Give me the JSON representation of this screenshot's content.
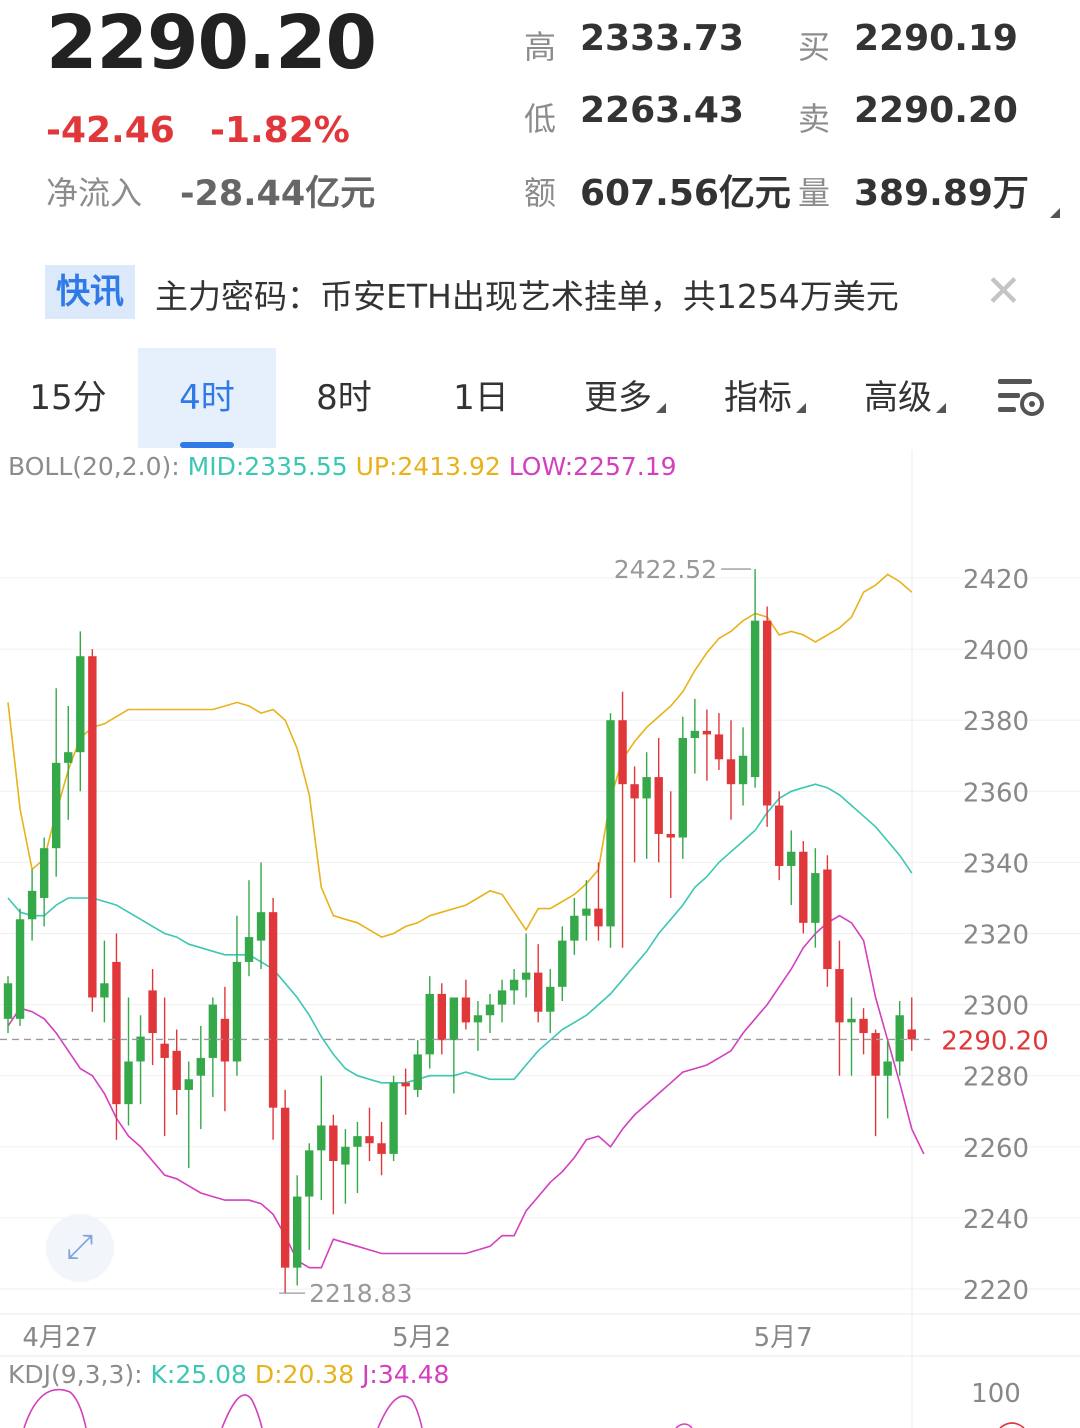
{
  "quote": {
    "last_price": "2290.20",
    "change": "-42.46",
    "change_pct": "-1.82%",
    "net_inflow_label": "净流入",
    "net_inflow_value": "-28.44亿元",
    "stats": [
      {
        "label": "高",
        "value": "2333.73"
      },
      {
        "label": "买",
        "value": "2290.19"
      },
      {
        "label": "低",
        "value": "2263.43"
      },
      {
        "label": "卖",
        "value": "2290.20"
      },
      {
        "label": "额",
        "value": "607.56亿元"
      },
      {
        "label": "量",
        "value": "389.89万"
      }
    ]
  },
  "news": {
    "tag": "快讯",
    "text": "主力密码：币安ETH出现艺术挂单，共1254万美元",
    "close_icon": "close-icon"
  },
  "tabs": [
    {
      "label": "15分",
      "active": false,
      "dropdown": false
    },
    {
      "label": "4时",
      "active": true,
      "dropdown": false
    },
    {
      "label": "8时",
      "active": false,
      "dropdown": false
    },
    {
      "label": "1日",
      "active": false,
      "dropdown": false
    },
    {
      "label": "更多",
      "active": false,
      "dropdown": true
    },
    {
      "label": "指标",
      "active": false,
      "dropdown": true
    },
    {
      "label": "高级",
      "active": false,
      "dropdown": true
    }
  ],
  "settings_icon": "chart-settings-icon",
  "expand_icon": "expand-icon",
  "colors": {
    "up": "#35a84a",
    "down": "#e0373b",
    "mid": "#3cc7b4",
    "upper": "#e8b21a",
    "lower": "#d43fbf",
    "accent": "#2f7ae6",
    "current_price_label": "#e0373b"
  },
  "boll_legend": {
    "prefix": "BOLL(20,2.0):",
    "mid": "MID:2335.55",
    "up": "UP:2413.92",
    "low": "LOW:2257.19"
  },
  "kdj_legend": {
    "prefix": "KDJ(9,3,3):",
    "k": "K:25.08",
    "d": "D:20.38",
    "j": "J:34.48"
  },
  "chart_data": {
    "type": "candlestick",
    "y_ticks": [
      "2420",
      "2400",
      "2380",
      "2360",
      "2340",
      "2320",
      "2300",
      "2280",
      "2260",
      "2240",
      "2220"
    ],
    "ylim": [
      2215,
      2435
    ],
    "x_labels": [
      {
        "label": "4月27",
        "index": 4
      },
      {
        "label": "5月2",
        "index": 34
      },
      {
        "label": "5月7",
        "index": 64
      }
    ],
    "current_price": 2290.2,
    "current_price_label": "2290.20",
    "max_marker": {
      "label": "2422.52",
      "value": 2422.52,
      "index": 62
    },
    "min_marker": {
      "label": "2218.83",
      "value": 2218.83,
      "index": 22
    },
    "candles": [
      [
        2296,
        2308,
        2292,
        2306
      ],
      [
        2296,
        2327,
        2294,
        2324
      ],
      [
        2324,
        2338,
        2318,
        2332
      ],
      [
        2330,
        2347,
        2322,
        2344
      ],
      [
        2344,
        2389,
        2336,
        2368
      ],
      [
        2368,
        2384,
        2352,
        2371
      ],
      [
        2371,
        2405,
        2360,
        2398
      ],
      [
        2398,
        2400,
        2298,
        2302
      ],
      [
        2302,
        2318,
        2295,
        2306
      ],
      [
        2312,
        2320,
        2262,
        2272
      ],
      [
        2272,
        2302,
        2266,
        2284
      ],
      [
        2284,
        2297,
        2272,
        2291
      ],
      [
        2304,
        2310,
        2283,
        2292
      ],
      [
        2289,
        2302,
        2263,
        2285
      ],
      [
        2287,
        2293,
        2269,
        2276
      ],
      [
        2276,
        2284,
        2254,
        2279
      ],
      [
        2280,
        2294,
        2265,
        2285
      ],
      [
        2285,
        2302,
        2274,
        2300
      ],
      [
        2296,
        2305,
        2270,
        2284
      ],
      [
        2284,
        2325,
        2280,
        2312
      ],
      [
        2312,
        2335,
        2308,
        2319
      ],
      [
        2318,
        2340,
        2310,
        2326
      ],
      [
        2326,
        2330,
        2262,
        2271
      ],
      [
        2271,
        2276,
        2218.83,
        2226
      ],
      [
        2226,
        2252,
        2221,
        2246
      ],
      [
        2246,
        2261,
        2231,
        2259
      ],
      [
        2259,
        2280,
        2245,
        2266
      ],
      [
        2266,
        2269,
        2241,
        2256
      ],
      [
        2255,
        2265,
        2244,
        2260
      ],
      [
        2260,
        2267,
        2247,
        2263
      ],
      [
        2263,
        2271,
        2256,
        2261
      ],
      [
        2261,
        2267,
        2252,
        2258
      ],
      [
        2258,
        2280,
        2256,
        2278
      ],
      [
        2278,
        2282,
        2269,
        2277
      ],
      [
        2276,
        2290,
        2274,
        2286
      ],
      [
        2286,
        2308,
        2282,
        2303
      ],
      [
        2303,
        2306,
        2286,
        2290
      ],
      [
        2290,
        2299,
        2275,
        2302
      ],
      [
        2302,
        2307,
        2293,
        2295
      ],
      [
        2295,
        2301,
        2287,
        2297
      ],
      [
        2297,
        2303,
        2292,
        2300
      ],
      [
        2300,
        2307,
        2295,
        2304
      ],
      [
        2304,
        2310,
        2300,
        2307
      ],
      [
        2307,
        2320,
        2302,
        2309
      ],
      [
        2309,
        2317,
        2295,
        2298
      ],
      [
        2298,
        2310,
        2292,
        2305
      ],
      [
        2305,
        2322,
        2301,
        2318
      ],
      [
        2318,
        2330,
        2314,
        2325
      ],
      [
        2325,
        2335,
        2318,
        2327
      ],
      [
        2327,
        2340,
        2318,
        2322
      ],
      [
        2322,
        2382,
        2316,
        2380
      ],
      [
        2380,
        2388,
        2316,
        2362
      ],
      [
        2362,
        2367,
        2340,
        2358
      ],
      [
        2358,
        2371,
        2341,
        2364
      ],
      [
        2364,
        2375,
        2340,
        2348
      ],
      [
        2348,
        2360,
        2330,
        2347
      ],
      [
        2347,
        2381,
        2341,
        2375
      ],
      [
        2375,
        2386,
        2365,
        2377
      ],
      [
        2377,
        2383,
        2363,
        2376
      ],
      [
        2376,
        2382,
        2366,
        2369
      ],
      [
        2369,
        2380,
        2352,
        2362
      ],
      [
        2362,
        2378,
        2356,
        2370
      ],
      [
        2364,
        2422.52,
        2361,
        2408
      ],
      [
        2408,
        2412,
        2350,
        2356
      ],
      [
        2356,
        2360,
        2335,
        2339
      ],
      [
        2339,
        2349,
        2328,
        2343
      ],
      [
        2343,
        2346,
        2320,
        2323
      ],
      [
        2323,
        2344,
        2316,
        2337
      ],
      [
        2338,
        2342,
        2305,
        2310
      ],
      [
        2310,
        2318,
        2280,
        2295
      ],
      [
        2295,
        2302,
        2280,
        2296
      ],
      [
        2296,
        2299,
        2286,
        2292
      ],
      [
        2292,
        2293,
        2263,
        2280
      ],
      [
        2280,
        2290,
        2268,
        2284
      ],
      [
        2284,
        2301,
        2280,
        2297
      ],
      [
        2293,
        2302,
        2287,
        2290.2
      ]
    ],
    "boll": {
      "upper": [
        2385,
        2355,
        2338,
        2341,
        2354,
        2366,
        2375,
        2378,
        2379,
        2381,
        2383,
        2383,
        2383,
        2383,
        2383,
        2383,
        2383,
        2383,
        2384,
        2385,
        2384,
        2382,
        2383,
        2380,
        2372,
        2359,
        2333,
        2325,
        2324,
        2323,
        2321,
        2319,
        2320,
        2322,
        2323,
        2325,
        2326,
        2327,
        2328,
        2330,
        2332,
        2331,
        2326,
        2321,
        2327,
        2327,
        2329,
        2331,
        2334,
        2338,
        2358,
        2369,
        2374,
        2378,
        2381,
        2384,
        2388,
        2394,
        2399,
        2403,
        2405,
        2408,
        2410,
        2409,
        2404,
        2405,
        2404,
        2402,
        2404,
        2406,
        2409,
        2416,
        2418,
        2421,
        2419,
        2416
      ],
      "mid": [
        2330,
        2326,
        2325,
        2325,
        2328,
        2330,
        2330,
        2330,
        2329,
        2328,
        2326,
        2324,
        2322,
        2320,
        2319,
        2317,
        2316,
        2315,
        2314,
        2314,
        2314,
        2312,
        2310,
        2306,
        2302,
        2297,
        2291,
        2286,
        2282,
        2280,
        2279,
        2278,
        2278,
        2278,
        2279,
        2280,
        2280,
        2280,
        2281,
        2280,
        2279,
        2279,
        2279,
        2283,
        2287,
        2290,
        2293,
        2295,
        2297,
        2300,
        2303,
        2307,
        2311,
        2315,
        2320,
        2324,
        2328,
        2333,
        2336,
        2340,
        2343,
        2346,
        2349,
        2354,
        2358,
        2360,
        2361,
        2362,
        2361,
        2359,
        2356,
        2353,
        2350,
        2346,
        2342,
        2337
      ],
      "lower": [
        2294,
        2299,
        2298,
        2296,
        2292,
        2287,
        2282,
        2280,
        2275,
        2268,
        2263,
        2260,
        2256,
        2252,
        2251,
        2249,
        2247,
        2246,
        2245,
        2245,
        2245,
        2244,
        2241,
        2235,
        2228,
        2226,
        2226,
        2234,
        2233,
        2232,
        2231,
        2230,
        2230,
        2230,
        2230,
        2230,
        2230,
        2230,
        2230,
        2231,
        2232,
        2235,
        2235,
        2242,
        2246,
        2250,
        2253,
        2257,
        2262,
        2263,
        2260,
        2265,
        2269,
        2272,
        2275,
        2278,
        2281,
        2282,
        2283,
        2285,
        2287,
        2292,
        2296,
        2300,
        2305,
        2310,
        2316,
        2320,
        2323,
        2325,
        2323,
        2318,
        2302,
        2290,
        2278,
        2265,
        2258
      ]
    }
  }
}
